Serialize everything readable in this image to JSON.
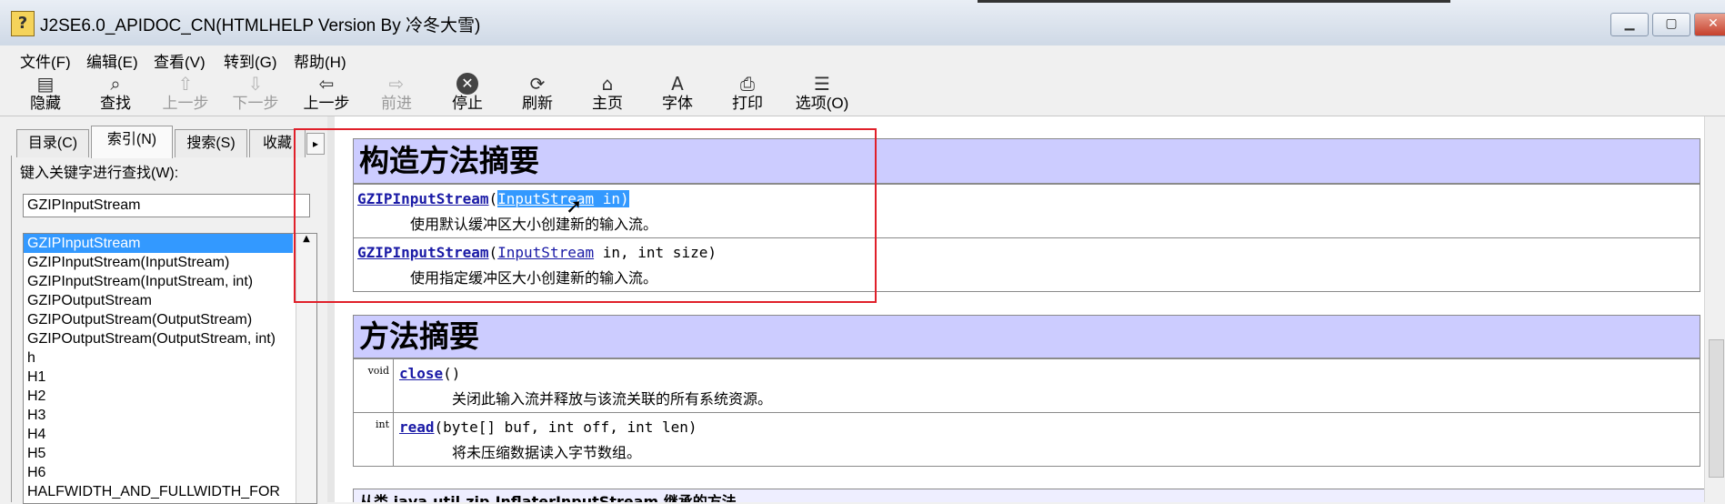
{
  "window": {
    "title": "J2SE6.0_APIDOC_CN(HTMLHELP Version By 冷冬大雪)",
    "min_glyph": "▁",
    "max_glyph": "▢",
    "close_glyph": "✕",
    "app_glyph": "?"
  },
  "menu": [
    "文件(F)",
    "编辑(E)",
    "查看(V)",
    "转到(G)",
    "帮助(H)"
  ],
  "toolbar": [
    {
      "label": "隐藏",
      "icon": "hide-icon",
      "glyph": "▤",
      "enabled": true
    },
    {
      "label": "查找",
      "icon": "find-icon",
      "glyph": "⌕",
      "enabled": true
    },
    {
      "label": "上一步",
      "icon": "prev-step-icon",
      "glyph": "⇧",
      "enabled": false
    },
    {
      "label": "下一步",
      "icon": "next-step-icon",
      "glyph": "⇩",
      "enabled": false
    },
    {
      "label": "上一步",
      "icon": "back-icon",
      "glyph": "⇦",
      "enabled": true
    },
    {
      "label": "前进",
      "icon": "forward-icon",
      "glyph": "⇨",
      "enabled": false
    },
    {
      "label": "停止",
      "icon": "stop-icon",
      "glyph": "✕",
      "enabled": true
    },
    {
      "label": "刷新",
      "icon": "refresh-icon",
      "glyph": "⟳",
      "enabled": true
    },
    {
      "label": "主页",
      "icon": "home-icon",
      "glyph": "⌂",
      "enabled": true
    },
    {
      "label": "字体",
      "icon": "font-icon",
      "glyph": "A",
      "enabled": true
    },
    {
      "label": "打印",
      "icon": "print-icon",
      "glyph": "⎙",
      "enabled": true
    },
    {
      "label": "选项(O)",
      "icon": "options-icon",
      "glyph": "☰",
      "enabled": true
    }
  ],
  "tabs": [
    {
      "label": "目录(C)",
      "active": false
    },
    {
      "label": "索引(N)",
      "active": true
    },
    {
      "label": "搜索(S)",
      "active": false
    },
    {
      "label": "收藏",
      "active": false
    }
  ],
  "tab_scroll_glyph": "▸",
  "index": {
    "label": "键入关键字进行查找(W):",
    "value": "GZIPInputStream",
    "scroll_up_glyph": "▲",
    "items": [
      "GZIPInputStream",
      "GZIPInputStream(InputStream)",
      "GZIPInputStream(InputStream, int)",
      "GZIPOutputStream",
      "GZIPOutputStream(OutputStream)",
      "GZIPOutputStream(OutputStream, int)",
      "h",
      "H1",
      "H2",
      "H3",
      "H4",
      "H5",
      "H6",
      "HALFWIDTH_AND_FULLWIDTH_FOR"
    ],
    "selected_index": 0
  },
  "content": {
    "constructor_heading": "构造方法摘要",
    "constructors": [
      {
        "name": "GZIPInputStream",
        "open": "(",
        "param_type": "InputStream",
        "rest": " in)",
        "desc": "使用默认缓冲区大小创建新的输入流。"
      },
      {
        "name": "GZIPInputStream",
        "open": "(",
        "param_type": "InputStream",
        "rest": " in, int size)",
        "desc": "使用指定缓冲区大小创建新的输入流。"
      }
    ],
    "method_heading": "方法摘要",
    "methods": [
      {
        "type": "void",
        "name": "close",
        "rest": "()",
        "desc": "关闭此输入流并释放与该流关联的所有系统资源。"
      },
      {
        "type": "int",
        "name": "read",
        "rest": "(byte[] buf, int off, int len)",
        "desc": "将未压缩数据读入字节数组。"
      }
    ],
    "inherited_partial": "从类 java.util.zip.InflaterInputStream 继承的方法"
  },
  "cursor_glyph": "➚",
  "colors": {
    "section_header": "#ccccff",
    "selection": "#3399ff",
    "annotation_box": "#e0202a",
    "link": "#1a1aa6"
  }
}
